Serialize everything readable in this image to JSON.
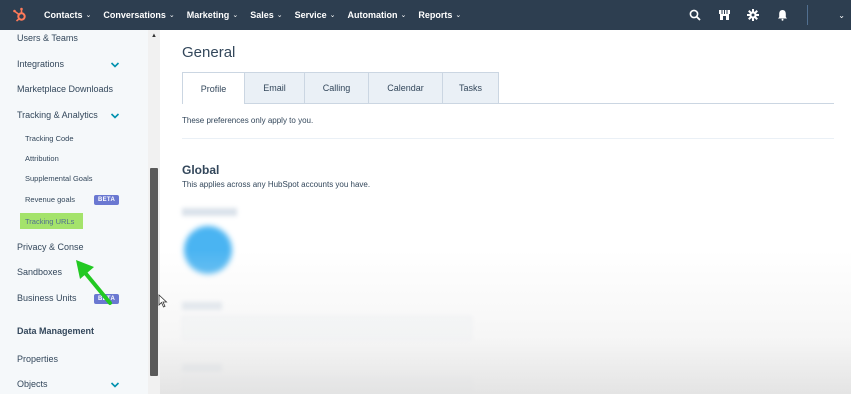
{
  "topnav": {
    "items": [
      {
        "label": "Contacts"
      },
      {
        "label": "Conversations"
      },
      {
        "label": "Marketing"
      },
      {
        "label": "Sales"
      },
      {
        "label": "Service"
      },
      {
        "label": "Automation"
      },
      {
        "label": "Reports"
      }
    ],
    "chevron": "⌄",
    "icons": [
      "search-icon",
      "marketplace-icon",
      "settings-gear-icon",
      "notifications-bell-icon"
    ],
    "brand_color": "#ff7a59",
    "bg_color": "#2d3e50"
  },
  "sidebar": {
    "users_teams": "Users & Teams",
    "integrations": "Integrations",
    "marketplace_downloads": "Marketplace Downloads",
    "tracking_analytics": "Tracking & Analytics",
    "tracking_code": "Tracking Code",
    "attribution": "Attribution",
    "supplemental_goals": "Supplemental Goals",
    "revenue_goals": "Revenue goals",
    "tracking_urls": "Tracking URLs",
    "privacy_consent": "Privacy & Conse",
    "sandboxes": "Sandboxes",
    "business_units": "Business Units",
    "data_management": "Data Management",
    "properties": "Properties",
    "objects": "Objects",
    "beta_label": "BETA",
    "highlight_color": "#a4e36b",
    "annotation_arrow_color": "#22c922"
  },
  "main": {
    "title": "General",
    "tabs": [
      {
        "label": "Profile"
      },
      {
        "label": "Email"
      },
      {
        "label": "Calling"
      },
      {
        "label": "Calendar"
      },
      {
        "label": "Tasks"
      }
    ],
    "preferences_note": "These preferences only apply to you.",
    "global_title": "Global",
    "global_subtitle": "This applies across any HubSpot accounts you have."
  }
}
